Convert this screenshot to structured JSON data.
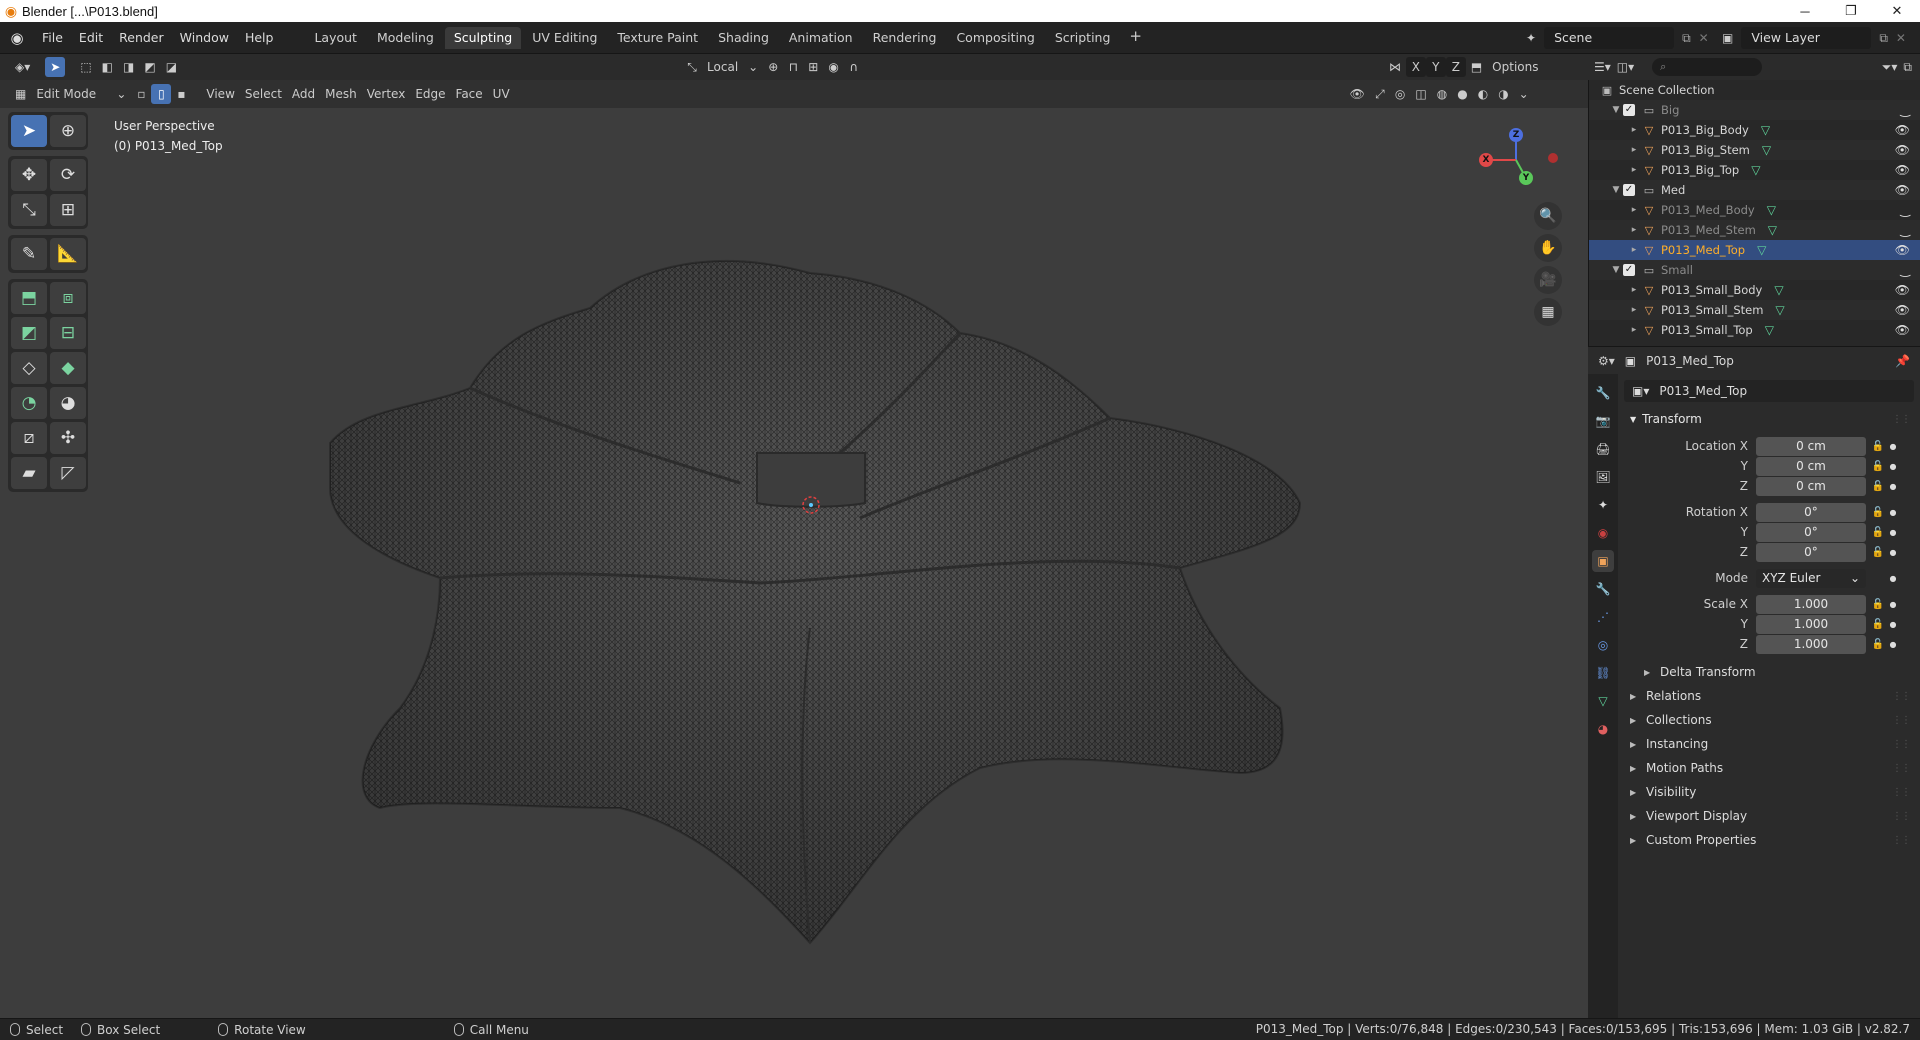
{
  "window": {
    "title": "Blender [...\\P013.blend]",
    "minimize": "─",
    "maximize": "❐",
    "close": "✕"
  },
  "menu": [
    "File",
    "Edit",
    "Render",
    "Window",
    "Help"
  ],
  "workspaces": {
    "tabs": [
      "Layout",
      "Modeling",
      "Sculpting",
      "UV Editing",
      "Texture Paint",
      "Shading",
      "Animation",
      "Rendering",
      "Compositing",
      "Scripting"
    ],
    "active": "Sculpting",
    "add": "+"
  },
  "scene": {
    "label": "Scene",
    "view_layer": "View Layer"
  },
  "viewport_header": {
    "transform_orientation": "Local",
    "axes": [
      "X",
      "Y",
      "Z"
    ],
    "options": "Options",
    "mode": "Edit Mode",
    "menus": [
      "View",
      "Select",
      "Add",
      "Mesh",
      "Vertex",
      "Edge",
      "Face",
      "UV"
    ]
  },
  "viewport": {
    "perspective": "User Perspective",
    "object_info": "(0) P013_Med_Top",
    "gizmo": {
      "x": "X",
      "y": "Y",
      "z": "Z"
    }
  },
  "outliner": {
    "root": "Scene Collection",
    "rows": [
      {
        "label": "Big",
        "type": "collection",
        "depth": 1,
        "dim": true
      },
      {
        "label": "P013_Big_Body",
        "type": "object",
        "depth": 2
      },
      {
        "label": "P013_Big_Stem",
        "type": "object",
        "depth": 2
      },
      {
        "label": "P013_Big_Top",
        "type": "object",
        "depth": 2
      },
      {
        "label": "Med",
        "type": "collection",
        "depth": 1
      },
      {
        "label": "P013_Med_Body",
        "type": "object",
        "depth": 2,
        "dim": true
      },
      {
        "label": "P013_Med_Stem",
        "type": "object",
        "depth": 2,
        "dim": true
      },
      {
        "label": "P013_Med_Top",
        "type": "object",
        "depth": 2,
        "selected": true
      },
      {
        "label": "Small",
        "type": "collection",
        "depth": 1,
        "dim": true
      },
      {
        "label": "P013_Small_Body",
        "type": "object",
        "depth": 2
      },
      {
        "label": "P013_Small_Stem",
        "type": "object",
        "depth": 2
      },
      {
        "label": "P013_Small_Top",
        "type": "object",
        "depth": 2
      }
    ]
  },
  "properties": {
    "header_object": "P013_Med_Top",
    "object_name": "P013_Med_Top",
    "transform_title": "Transform",
    "location": {
      "label": "Location X",
      "x": "0 cm",
      "y": "0 cm",
      "z": "0 cm"
    },
    "rotation": {
      "label": "Rotation X",
      "x": "0°",
      "y": "0°",
      "z": "0°"
    },
    "mode": {
      "label": "Mode",
      "value": "XYZ Euler"
    },
    "scale": {
      "label": "Scale X",
      "x": "1.000",
      "y": "1.000",
      "z": "1.000"
    },
    "axis_y": "Y",
    "axis_z": "Z",
    "delta_transform": "Delta Transform",
    "panels": [
      "Relations",
      "Collections",
      "Instancing",
      "Motion Paths",
      "Visibility",
      "Viewport Display",
      "Custom Properties"
    ]
  },
  "statusbar": {
    "select": "Select",
    "box_select": "Box Select",
    "rotate_view": "Rotate View",
    "call_menu": "Call Menu",
    "stats": "P013_Med_Top | Verts:0/76,848 | Edges:0/230,543 | Faces:0/153,695 | Tris:153,696 | Mem: 1.03 GiB | v2.82.7"
  },
  "colors": {
    "accent": "#4772b3",
    "selected_text": "#ffaf29",
    "mesh_icon": "#5fd29a",
    "viewport_bg": "#3d3d3d"
  }
}
